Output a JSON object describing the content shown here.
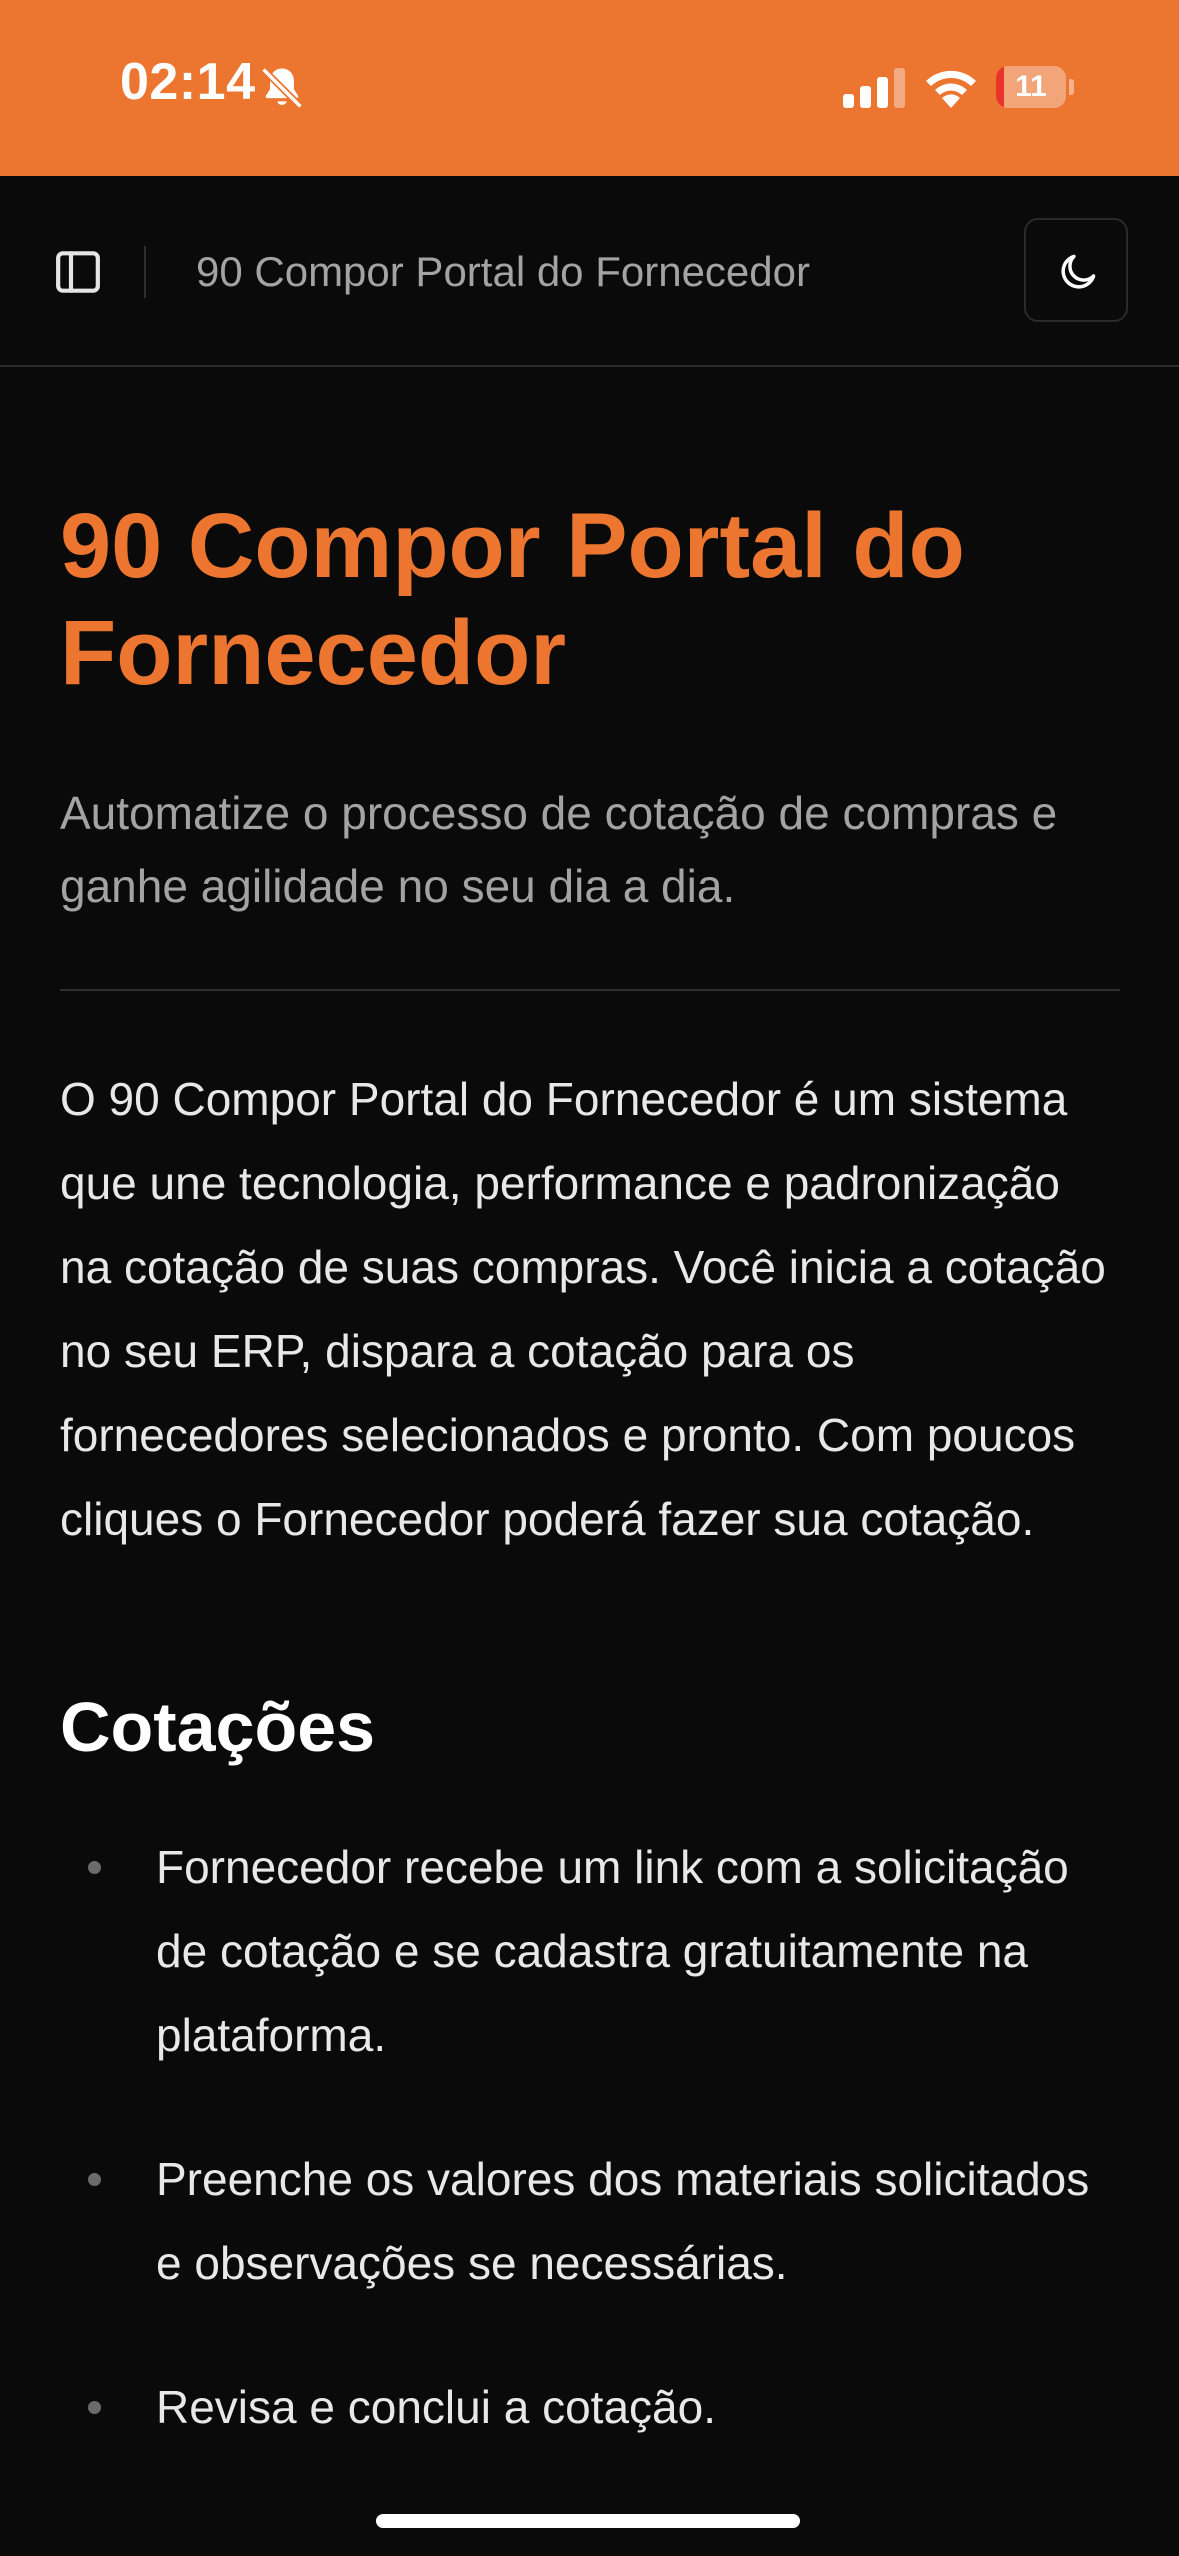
{
  "status_bar": {
    "time": "02:14",
    "battery_level": "11",
    "icons": [
      "bell-slash-icon",
      "cellular-signal-icon",
      "wifi-icon",
      "battery-icon"
    ],
    "background_color": "#ec7630"
  },
  "header": {
    "sidebar_icon": "sidebar-panel-icon",
    "title": "90 Compor Portal do Fornecedor",
    "theme_icon": "moon-icon"
  },
  "main": {
    "title": "90 Compor Portal do Fornecedor",
    "subtitle": "Automatize o processo de cotação de compras e ganhe agilidade no seu dia a dia.",
    "intro": "O 90 Compor Portal do Fornecedor é um sistema que une tecnologia, performance e padronização na cotação de suas compras. Você inicia a cotação no seu ERP, dispara a cotação para os fornecedores selecionados e pronto. Com poucos cliques o Fornecedor poderá fazer sua cotação.",
    "section_heading": "Cotações",
    "bullets": [
      "Fornecedor recebe um link com a solicitação de cotação e se cadastra gratuitamente na plataforma.",
      "Preenche os valores dos materiais solicitados e observações se necessárias.",
      "Revisa e conclui a cotação."
    ]
  },
  "colors": {
    "accent": "#ec7630",
    "background": "#0a0a0a",
    "muted_text": "#a3a3a3",
    "battery_low": "#e8342a"
  }
}
